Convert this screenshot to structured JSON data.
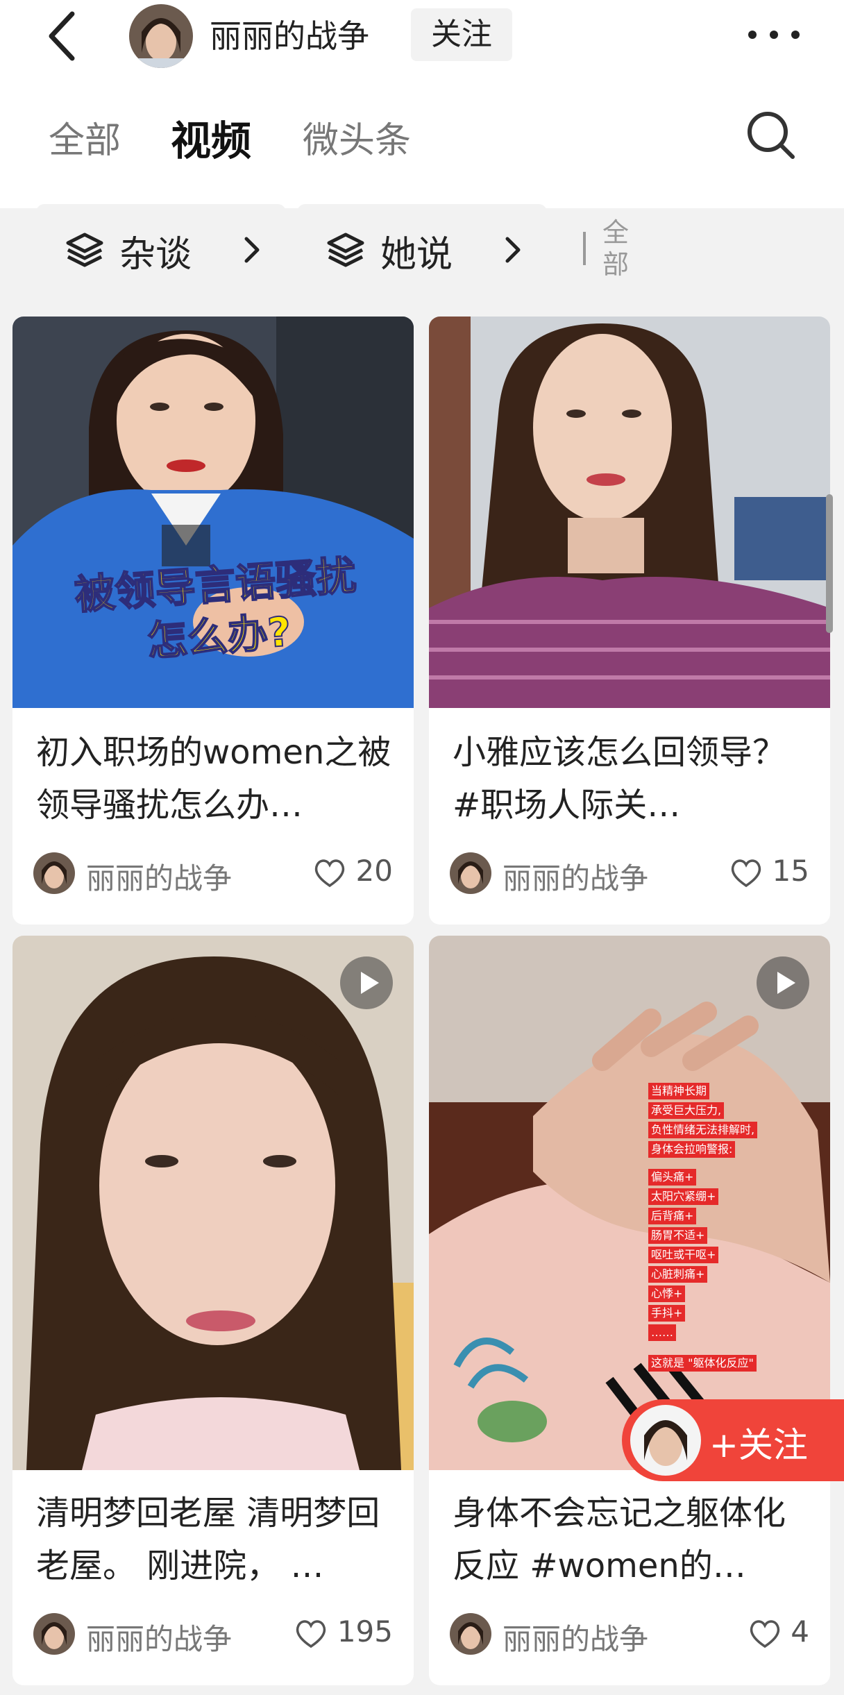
{
  "header": {
    "title": "丽丽的战争",
    "follow_label": "关注"
  },
  "tabs": [
    {
      "label": "全部",
      "active": false
    },
    {
      "label": "视频",
      "active": true
    },
    {
      "label": "微头条",
      "active": false
    }
  ],
  "chips": [
    {
      "label": "杂谈"
    },
    {
      "label": "她说"
    }
  ],
  "chips_all_label": "全部",
  "cards": [
    {
      "title": "初入职场的women之被领导骚扰怎么办…",
      "overlay": "被领导言语骚扰\n怎么办?",
      "author": "丽丽的战争",
      "likes": "20"
    },
    {
      "title": "小雅应该怎么回领导？ #职场人际关…",
      "author": "丽丽的战争",
      "likes": "15"
    },
    {
      "title": "清明梦回老屋 清明梦回老屋。 刚进院，  …",
      "author": "丽丽的战争",
      "likes": "195"
    },
    {
      "title": "身体不会忘记之躯体化反应 #women的…",
      "author": "丽丽的战争",
      "likes": "4",
      "overlay_lines": [
        "当精神长期",
        "承受巨大压力,",
        "负性情绪无法排解时,",
        "身体会拉响警报:",
        "偏头痛+",
        "太阳穴紧绷+",
        "后背痛+",
        "肠胃不适+",
        "呕吐或干呕+",
        "心脏刺痛+",
        "心悸+",
        "手抖+",
        "……",
        "这就是 \"躯体化反应\""
      ]
    }
  ],
  "floating_follow_label": "+关注",
  "colors": {
    "accent": "#f0443a",
    "overlay_text": "#ffe400",
    "red_tag": "#e52a2a"
  }
}
